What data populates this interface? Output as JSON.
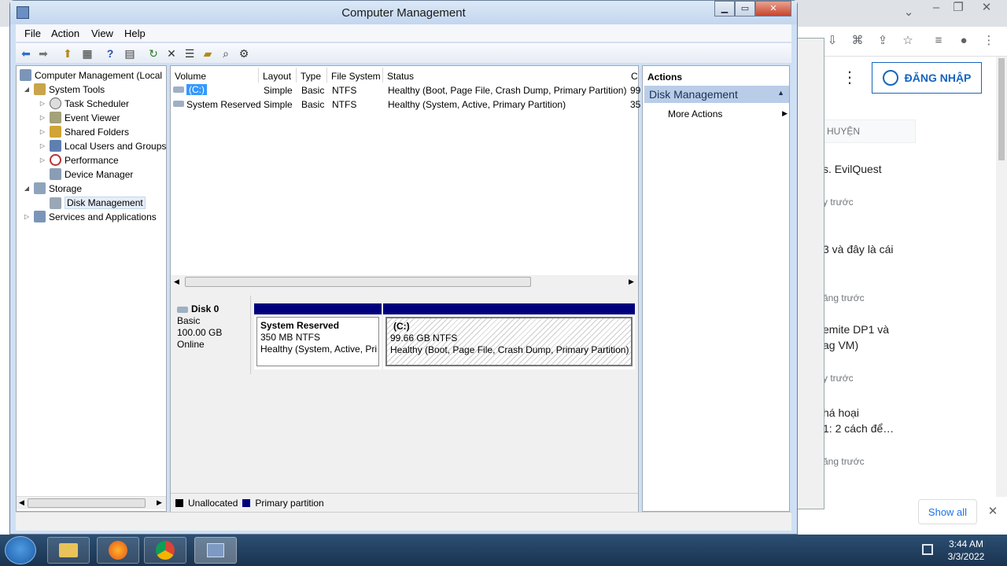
{
  "window": {
    "title": "Computer Management"
  },
  "menu": [
    "File",
    "Action",
    "View",
    "Help"
  ],
  "tree": {
    "root": "Computer Management (Local",
    "items": [
      {
        "label": "System Tools",
        "level": 1
      },
      {
        "label": "Task Scheduler",
        "level": 2
      },
      {
        "label": "Event Viewer",
        "level": 2
      },
      {
        "label": "Shared Folders",
        "level": 2
      },
      {
        "label": "Local Users and Groups",
        "level": 2
      },
      {
        "label": "Performance",
        "level": 2
      },
      {
        "label": "Device Manager",
        "level": 2
      },
      {
        "label": "Storage",
        "level": 1
      },
      {
        "label": "Disk Management",
        "level": 2,
        "selected": true
      },
      {
        "label": "Services and Applications",
        "level": 1
      }
    ]
  },
  "volumes": {
    "headers": [
      "Volume",
      "Layout",
      "Type",
      "File System",
      "Status",
      "C"
    ],
    "rows": [
      {
        "volume": "(C:)",
        "layout": "Simple",
        "type": "Basic",
        "fs": "NTFS",
        "status": "Healthy (Boot, Page File, Crash Dump, Primary Partition)",
        "cap": "99"
      },
      {
        "volume": "System Reserved",
        "layout": "Simple",
        "type": "Basic",
        "fs": "NTFS",
        "status": "Healthy (System, Active, Primary Partition)",
        "cap": "35"
      }
    ]
  },
  "disk": {
    "name": "Disk 0",
    "type": "Basic",
    "size": "100.00 GB",
    "state": "Online"
  },
  "partitions": [
    {
      "name": "System Reserved",
      "size": "350 MB NTFS",
      "status": "Healthy (System, Active, Pri"
    },
    {
      "name": "(C:)",
      "size": "99.66 GB NTFS",
      "status": "Healthy (Boot, Page File, Crash Dump, Primary Partition)"
    }
  ],
  "legend": {
    "unallocated": "Unallocated",
    "primary": "Primary partition"
  },
  "actions": {
    "header": "Actions",
    "section": "Disk Management",
    "item": "More Actions"
  },
  "browser": {
    "login": "ĐĂNG NHẬP",
    "search_label": "HUYỆN",
    "feed": [
      "s. EvilQuest",
      "y trước",
      "3 và đây là cái",
      "ăng trước",
      "emite DP1 và",
      "ag VM)",
      "y trước",
      "há hoại",
      "1: 2 cách để…",
      "ăng trước"
    ],
    "show_all": "Show all"
  },
  "taskbar": {
    "time": "3:44 AM",
    "date": "3/3/2022"
  },
  "colors": {
    "primary_partition": "#00007d",
    "selection": "#b9cde8"
  }
}
